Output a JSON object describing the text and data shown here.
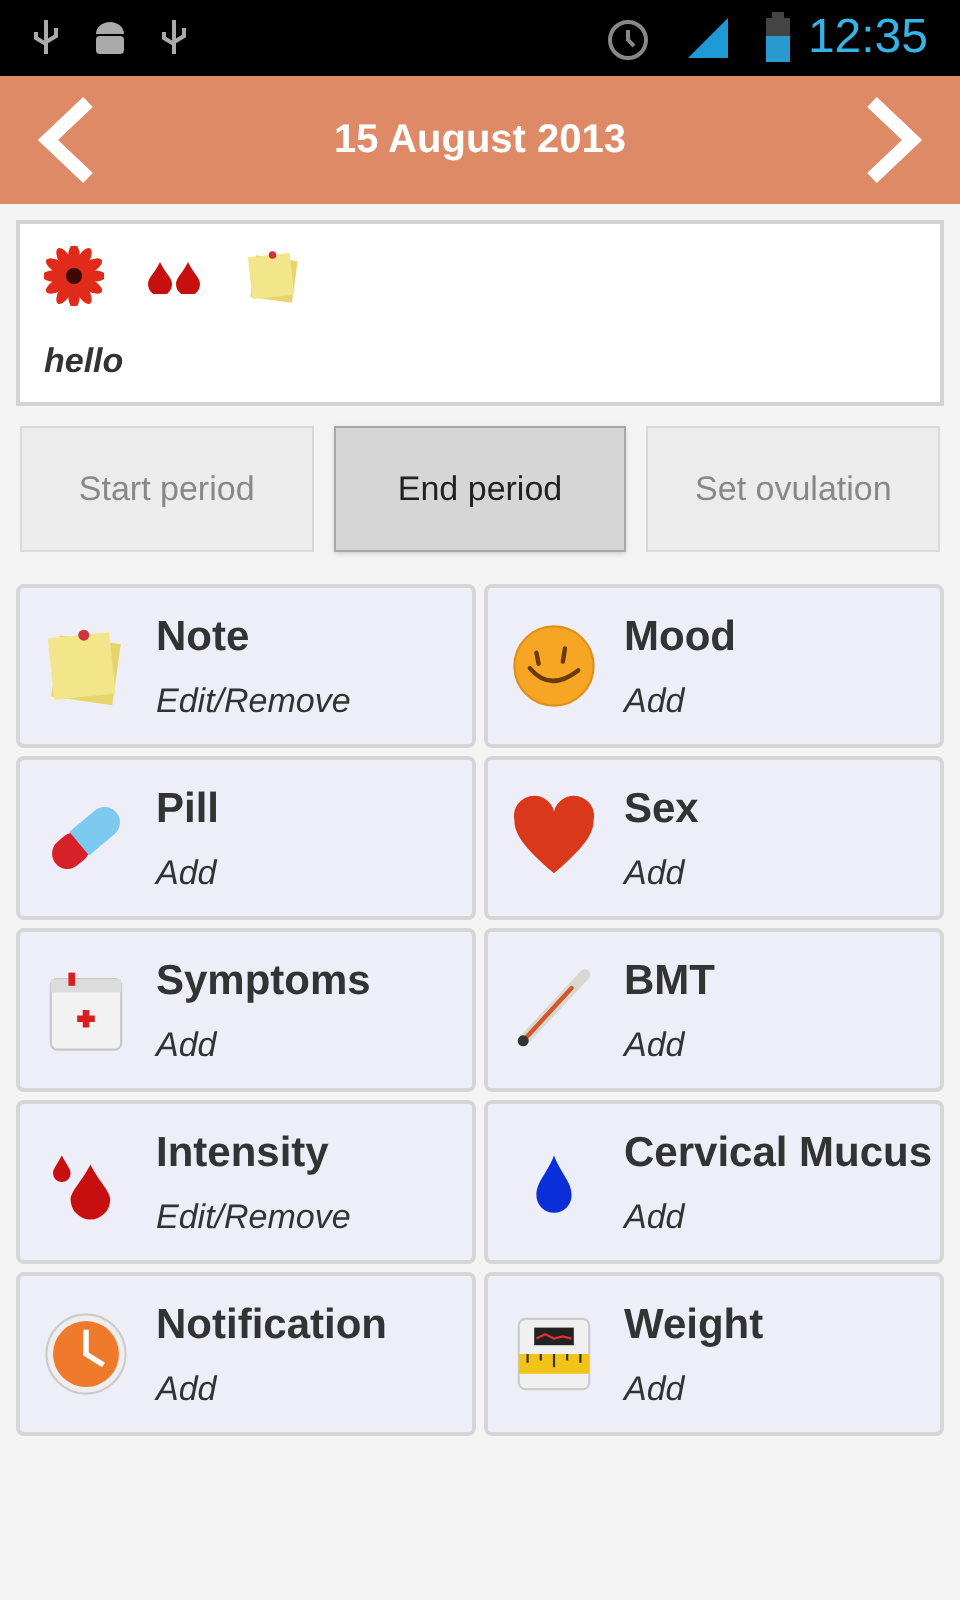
{
  "status_bar": {
    "time": "12:35"
  },
  "header": {
    "title": "15 August 2013"
  },
  "summary": {
    "icons": [
      {
        "kind": "flower"
      },
      {
        "kind": "drops"
      },
      {
        "kind": "note"
      }
    ],
    "text": "hello"
  },
  "actions": [
    {
      "label": "Start period",
      "disabled": true
    },
    {
      "label": "End period",
      "disabled": false
    },
    {
      "label": "Set ovulation",
      "disabled": true
    }
  ],
  "tiles": [
    {
      "kind": "note",
      "title": "Note",
      "subtitle": "Edit/Remove"
    },
    {
      "kind": "mood",
      "title": "Mood",
      "subtitle": "Add"
    },
    {
      "kind": "pill",
      "title": "Pill",
      "subtitle": "Add"
    },
    {
      "kind": "sex",
      "title": "Sex",
      "subtitle": "Add"
    },
    {
      "kind": "symptoms",
      "title": "Symptoms",
      "subtitle": "Add"
    },
    {
      "kind": "bmt",
      "title": "BMT",
      "subtitle": "Add"
    },
    {
      "kind": "intensity",
      "title": "Intensity",
      "subtitle": "Edit/Remove"
    },
    {
      "kind": "mucus",
      "title": "Cervical Mucus",
      "subtitle": "Add"
    },
    {
      "kind": "notification",
      "title": "Notification",
      "subtitle": "Add"
    },
    {
      "kind": "weight",
      "title": "Weight",
      "subtitle": "Add"
    }
  ]
}
